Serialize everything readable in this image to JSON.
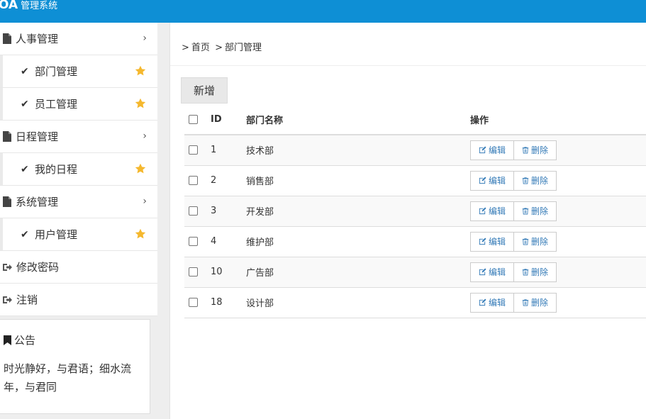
{
  "header": {
    "logo": "OA",
    "title": "管理系统"
  },
  "sidebar": {
    "items": [
      {
        "type": "group",
        "label": "人事管理"
      },
      {
        "type": "sub",
        "label": "部门管理"
      },
      {
        "type": "sub",
        "label": "员工管理"
      },
      {
        "type": "group",
        "label": "日程管理"
      },
      {
        "type": "sub",
        "label": "我的日程"
      },
      {
        "type": "group",
        "label": "系统管理"
      },
      {
        "type": "sub",
        "label": "用户管理"
      },
      {
        "type": "plain",
        "label": "修改密码"
      },
      {
        "type": "plain",
        "label": "注销"
      }
    ],
    "notice": {
      "title": "公告",
      "text": "时光静好，与君语；细水流年，与君同"
    }
  },
  "breadcrumb": {
    "home": "首页",
    "current": "部门管理",
    "separator": ">"
  },
  "toolbar": {
    "add_label": "新增"
  },
  "table": {
    "headers": {
      "id": "ID",
      "name": "部门名称",
      "ops": "操作"
    },
    "rows": [
      {
        "id": "1",
        "name": "技术部"
      },
      {
        "id": "2",
        "name": "销售部"
      },
      {
        "id": "3",
        "name": "开发部"
      },
      {
        "id": "4",
        "name": "维护部"
      },
      {
        "id": "10",
        "name": "广告部"
      },
      {
        "id": "18",
        "name": "设计部"
      }
    ],
    "edit_label": "编辑",
    "delete_label": "删除"
  },
  "colors": {
    "topbar": "#0e8fd5",
    "star": "#f5b82e",
    "link": "#337ab7"
  }
}
